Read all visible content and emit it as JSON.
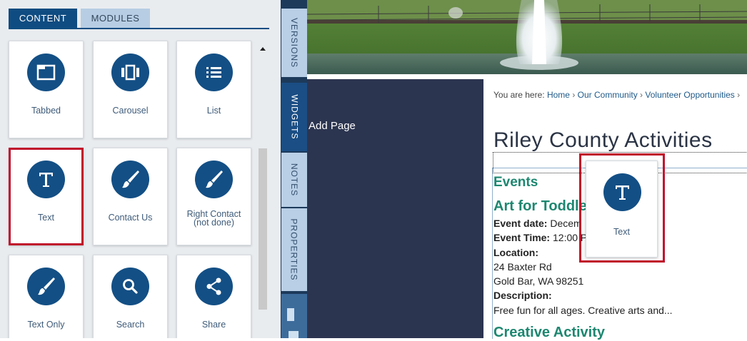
{
  "panel": {
    "tabs": [
      {
        "label": "CONTENT",
        "active": true
      },
      {
        "label": "MODULES",
        "active": false
      }
    ],
    "widgets": [
      {
        "label": "Tabbed",
        "icon": "tabbed-window-icon"
      },
      {
        "label": "Carousel",
        "icon": "carousel-icon"
      },
      {
        "label": "List",
        "icon": "list-icon"
      },
      {
        "label": "Text",
        "icon": "text-t-icon",
        "selected": true
      },
      {
        "label": "Contact Us",
        "icon": "paintbrush-icon"
      },
      {
        "label": "Right Contact",
        "label_line2": "(not done)",
        "icon": "paintbrush-icon"
      },
      {
        "label": "Text Only",
        "icon": "paintbrush-icon"
      },
      {
        "label": "Search",
        "icon": "search-icon"
      },
      {
        "label": "Share",
        "icon": "share-icon"
      }
    ]
  },
  "side_tabs": [
    {
      "label": "VERSIONS"
    },
    {
      "label": "WIDGETS",
      "active": true
    },
    {
      "label": "NOTES"
    },
    {
      "label": "PROPERTIES"
    }
  ],
  "page": {
    "nav_label": "Add Page",
    "breadcrumb": {
      "prefix": "You are here:",
      "items": [
        "Home",
        "Our Community",
        "Volunteer Opportunities"
      ]
    },
    "title": "Riley County Activities",
    "section_heading": "Events",
    "event": {
      "name": "Art for Toddle",
      "date_label": "Event date:",
      "date_value": "Decem",
      "time_label": "Event Time:",
      "time_value": "12:00 P",
      "location_label": "Location:",
      "address_line1": "24 Baxter Rd",
      "address_line2": "Gold Bar, WA 98251",
      "description_label": "Description:",
      "description": "Free fun for all ages. Creative arts and..."
    },
    "next_event_name": "Creative Activity"
  },
  "drag_ghost": {
    "label": "Text",
    "icon": "text-t-icon"
  },
  "colors": {
    "primary": "#0f4c81",
    "icon_circle": "#134f85",
    "highlight": "#c0102a",
    "heading_teal": "#1d8770",
    "nav_dark": "#2c3550"
  }
}
